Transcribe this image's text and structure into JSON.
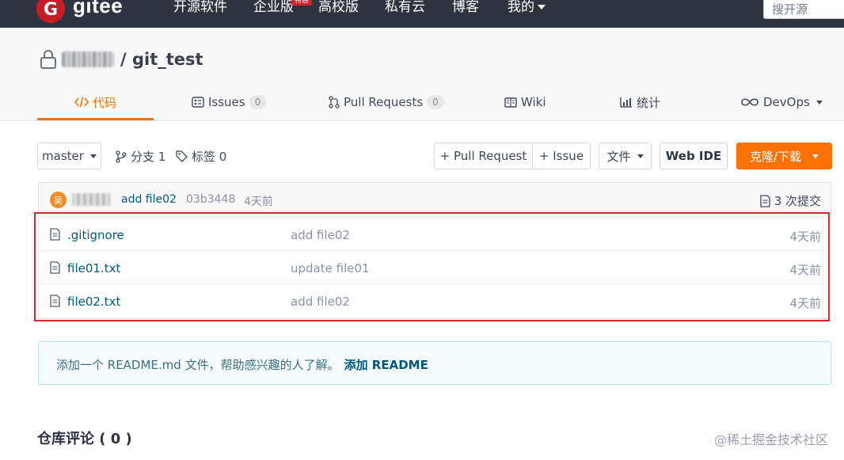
{
  "topnav": {
    "logo_letter": "G",
    "brand": "gitee",
    "items": [
      "开源软件",
      "企业版",
      "高校版",
      "私有云",
      "博客",
      "我的"
    ],
    "enterprise_badge": "特惠",
    "search_placeholder": "搜开源"
  },
  "repo": {
    "title": "/ git_test"
  },
  "tabs": [
    {
      "label": "代码",
      "icon": "code-icon"
    },
    {
      "label": "Issues",
      "count": "0",
      "icon": "issues-icon"
    },
    {
      "label": "Pull Requests",
      "count": "0",
      "icon": "pull-request-icon"
    },
    {
      "label": "Wiki",
      "icon": "wiki-icon"
    },
    {
      "label": "统计",
      "icon": "stats-icon"
    },
    {
      "label": "DevOps",
      "icon": "devops-icon"
    }
  ],
  "toolbar": {
    "branch": "master",
    "branches": "分支 1",
    "tags": "标签 0",
    "pull_request": "+ Pull Request",
    "issue": "+ Issue",
    "file": "文件",
    "web_ide": "Web IDE",
    "clone": "克隆/下载"
  },
  "commit": {
    "avatar_text": "吴",
    "message": "add file02",
    "sha": "03b3448",
    "time": "4天前",
    "count": "3 次提交"
  },
  "files": [
    {
      "name": ".gitignore",
      "commit": "add file02",
      "time": "4天前"
    },
    {
      "name": "file01.txt",
      "commit": "update file01",
      "time": "4天前"
    },
    {
      "name": "file02.txt",
      "commit": "add file02",
      "time": "4天前"
    }
  ],
  "readme": {
    "notice": "添加一个 README.md 文件，帮助感兴趣的人了解。",
    "link": "添加 README"
  },
  "comments": {
    "title": "仓库评论 ( 0 )"
  },
  "watermark": "@稀土掘金技术社区",
  "colors": {
    "nav_bg": "#2f3441",
    "accent": "#fe7300",
    "link": "#005980",
    "highlight": "#d8282e"
  }
}
